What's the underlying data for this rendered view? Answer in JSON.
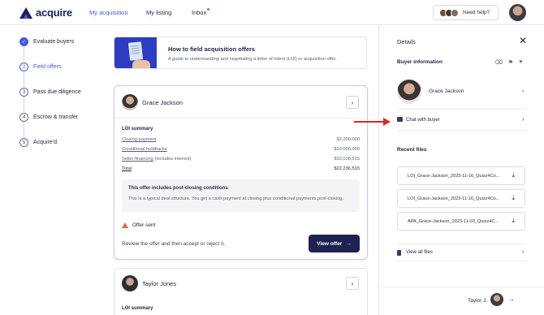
{
  "brand": {
    "name": "acquire",
    "color": "#1c1f5e"
  },
  "nav": {
    "items": [
      {
        "label": "My acquisition",
        "active": true
      },
      {
        "label": "My listing",
        "active": false
      },
      {
        "label": "Inbox",
        "active": false,
        "has_dot": true
      }
    ],
    "help_label": "Need help?"
  },
  "steps": [
    {
      "number": "✓",
      "label": "Evaluate buyers",
      "state": "done"
    },
    {
      "number": "2",
      "label": "Field offers",
      "state": "current"
    },
    {
      "number": "3",
      "label": "Pass due diligence",
      "state": "todo"
    },
    {
      "number": "4",
      "label": "Escrow & transfer",
      "state": "todo"
    },
    {
      "number": "5",
      "label": "Acquire'd",
      "state": "todo"
    }
  ],
  "guide": {
    "title": "How to field acquisition offers",
    "subtitle": "A guide to understanding and negotiating a letter of intent (LOI) or acquisition offer."
  },
  "offer": {
    "buyer_name": "Grace Jackson",
    "loi_title": "LOI summary",
    "rows": [
      {
        "label": "Closing payment",
        "extra": "",
        "amount": "$2,200,000"
      },
      {
        "label": "Conditional holdbacks",
        "extra": "",
        "amount": "$10,000,000"
      },
      {
        "label": "Seller financing",
        "extra": " (includes interest)",
        "amount": "$10,036,515"
      },
      {
        "label": "Total",
        "extra": "",
        "amount": "$22,236,515"
      }
    ],
    "condition_title": "This offer includes post-closing conditions",
    "condition_text": "This is a typical deal structure. You get a cash payment at closing plus conditional payments post-closing.",
    "status": "Offer sent",
    "review_text": "Review the offer and then accept or reject it.",
    "view_button": "View offer"
  },
  "offer2": {
    "buyer_name": "Taylor Jones",
    "loi_title": "LOI summary"
  },
  "details": {
    "title": "Details",
    "buyer_info_title": "Buyer information",
    "buyer_name": "Grace Jackson",
    "chat_label": "Chat with buyer",
    "recent_files_title": "Recent files",
    "files": [
      "LOI_Grace-Jackson_2023-11-16_Quizz4Co...",
      "LOI_Grace-Jackson_2023-11-16_Quizz4Co...",
      "APA_Grace-Jackson_2023-11-03_Quizz4C..."
    ],
    "view_all_label": "View all files",
    "next_label": "Taylor J."
  },
  "colors": {
    "accent": "#4a55e0",
    "dark_button": "#1f2250",
    "warning": "#e06a3a",
    "annotation_arrow": "#d42b2b"
  }
}
